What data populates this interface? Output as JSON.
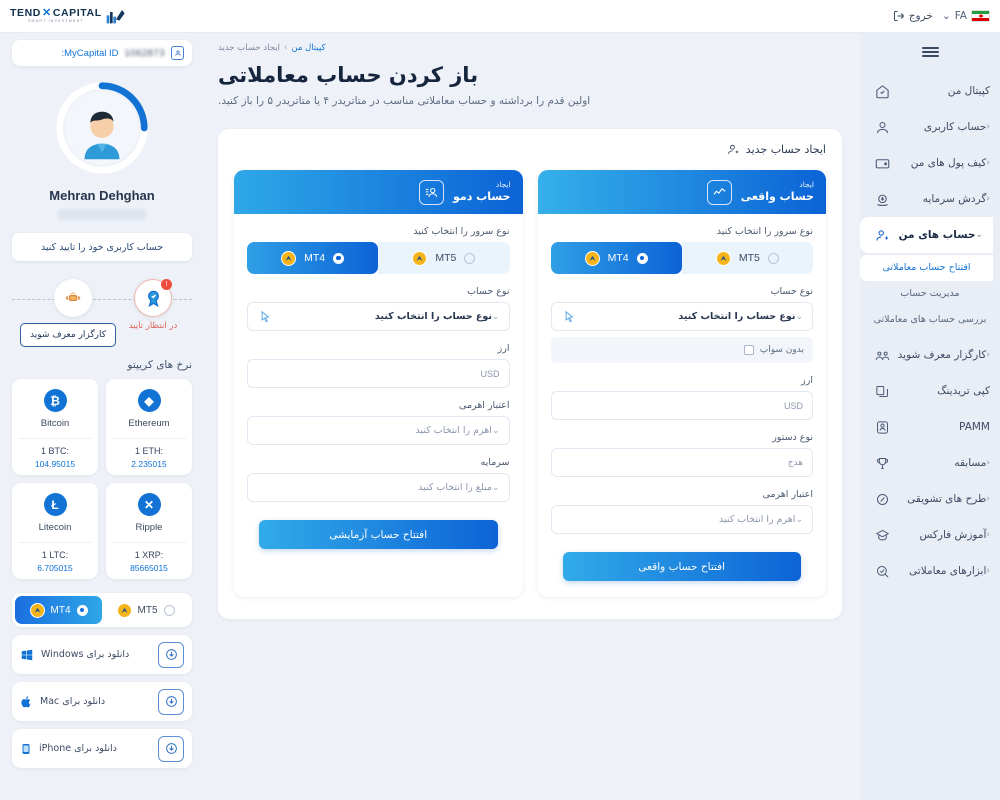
{
  "topbar": {
    "logo_main": "CAPITAL",
    "logo_x": "✕",
    "logo_main2": "TEND",
    "logo_sub": "SMART INVESTMENT",
    "language": "FA",
    "logout": "خروج"
  },
  "sidebar": {
    "items": [
      {
        "label": "کپیتال من",
        "icon": "home-icon",
        "chevron": "",
        "active": false
      },
      {
        "label": "حساب کاربری",
        "icon": "user-icon",
        "chevron": "‹",
        "active": false
      },
      {
        "label": "کیف پول های من",
        "icon": "wallet-icon",
        "chevron": "‹",
        "active": false
      },
      {
        "label": "گردش سرمایه",
        "icon": "capital-flow-icon",
        "chevron": "‹",
        "active": false
      },
      {
        "label": "حساب های من",
        "icon": "accounts-icon",
        "chevron": "⌄",
        "active": true
      }
    ],
    "sub_items": [
      {
        "label": "افتتاح حساب معاملاتی",
        "active": true
      },
      {
        "label": "مدیریت حساب",
        "active": false
      },
      {
        "label": "بررسی حساب های معاملاتی",
        "active": false
      }
    ],
    "items_after": [
      {
        "label": "کارگزار معرف شوید",
        "icon": "partners-icon",
        "chevron": "‹"
      },
      {
        "label": "کپی تریدینگ",
        "icon": "copy-trading-icon",
        "chevron": ""
      },
      {
        "label": "PAMM",
        "icon": "pamm-icon",
        "chevron": ""
      },
      {
        "label": "مسابقه",
        "icon": "trophy-icon",
        "chevron": "‹"
      },
      {
        "label": "طرح های تشویقی",
        "icon": "bonus-icon",
        "chevron": "‹"
      },
      {
        "label": "آموزش فارکس",
        "icon": "education-icon",
        "chevron": "‹"
      },
      {
        "label": "ابزارهای معاملاتی",
        "icon": "tools-icon",
        "chevron": "‹"
      }
    ]
  },
  "profile": {
    "id_label": "MyCapital ID:",
    "id_value": "1062873",
    "name": "Mehran Dehghan",
    "verify_button": "حساب کاربری خود را تایید کنید",
    "pending_label": "در انتظار تایید",
    "pending_badge": "!",
    "broker_button": "کارگزار معرف شوید"
  },
  "crypto": {
    "title": "نرخ های کریپتو",
    "coins": [
      {
        "name": "Bitcoin",
        "symbol": "₿",
        "pair": "1 BTC:",
        "price": "104.95015",
        "color": "#1273d4"
      },
      {
        "name": "Ethereum",
        "symbol": "◆",
        "pair": "1 ETH:",
        "price": "2.235015",
        "color": "#1273d4"
      },
      {
        "name": "Litecoin",
        "symbol": "Ł",
        "pair": "1 LTC:",
        "price": "6.705015",
        "color": "#1273d4"
      },
      {
        "name": "Ripple",
        "symbol": "✕",
        "pair": "1 XRP:",
        "price": "85665015",
        "color": "#1273d4"
      }
    ]
  },
  "platform": {
    "mt4": "MT4",
    "mt5": "MT5",
    "selected": "MT4",
    "downloads": [
      {
        "label": "دانلود برای Windows",
        "icon": "windows-icon"
      },
      {
        "label": "دانلود برای Mac",
        "icon": "apple-icon"
      },
      {
        "label": "دانلود برای iPhone",
        "icon": "iphone-icon"
      }
    ]
  },
  "main": {
    "breadcrumb_current": "ایجاد حساب جدید",
    "breadcrumb_sep": "‹",
    "breadcrumb_root": "کپیتال من",
    "title": "باز کردن حساب معاملاتی",
    "subtitle": "اولین قدم را برداشته و حساب معاملاتی مناسب در متاتریدر ۴ یا متاتریدر ۵ را باز کنید.",
    "panel_heading": "ایجاد حساب جدید"
  },
  "demo_card": {
    "head_small": "ایجاد",
    "head_big": "حساب دمو",
    "server_label": "نوع سرور را انتخاب کنید",
    "mt4": "MT4",
    "mt5": "MT5",
    "account_type_label": "نوع حساب",
    "account_type_placeholder": "نوع حساب را انتخاب کنید",
    "currency_label": "ارز",
    "currency_value": "USD",
    "leverage_label": "اعتبار اهرمی",
    "leverage_placeholder": "اهرم را انتخاب کنید",
    "capital_label": "سرمایه",
    "capital_placeholder": "مبلغ را انتخاب کنید",
    "submit": "افتتاح حساب آزمایشی"
  },
  "real_card": {
    "head_small": "ایجاد",
    "head_big": "حساب واقعی",
    "server_label": "نوع سرور را انتخاب کنید",
    "mt4": "MT4",
    "mt5": "MT5",
    "account_type_label": "نوع حساب",
    "account_type_placeholder": "نوع حساب را انتخاب کنید",
    "swap_free_label": "بدون سواپ",
    "currency_label": "ارز",
    "currency_value": "USD",
    "order_type_label": "نوع دستور",
    "order_type_value": "هدج",
    "leverage_label": "اعتبار اهرمی",
    "leverage_placeholder": "اهرم را انتخاب کنید",
    "submit": "افتتاح حساب واقعی"
  },
  "colors": {
    "accent": "#1273d4",
    "accent_light": "#2fa8e8",
    "bg": "#eef1f7",
    "sidebar": "#e9edf5",
    "danger": "#ef4b3c"
  }
}
